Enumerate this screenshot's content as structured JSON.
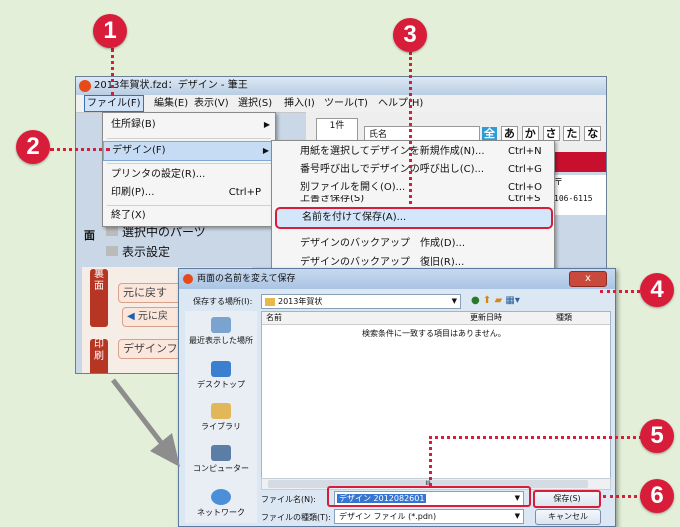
{
  "app": {
    "title": "2013年賀状.fzd：デザイン - 筆王",
    "menu": [
      "ファイル(F)",
      "編集(E)",
      "表示(V)",
      "選択(S)",
      "挿入(I)",
      "ツール(T)",
      "ヘルプ(H)"
    ],
    "ribbon": {
      "count_label": "1件",
      "name_label": "氏名",
      "kana_tabs": [
        "全",
        "あ",
        "か",
        "さ",
        "た",
        "な",
        "は"
      ],
      "postal_mark": "〒",
      "postal_code": "106-6115"
    },
    "side": {
      "face_label": "面",
      "selected_parts": "選択中のパーツ",
      "display_settings": "表示設定",
      "back_strip": [
        "裏",
        "面"
      ],
      "print_strip": [
        "印",
        "刷"
      ],
      "undo_label": "元に戻す",
      "undo_btn": "元に戻",
      "design_label": "デザインフ"
    }
  },
  "file_menu": {
    "items": [
      {
        "label": "住所録(B)",
        "shortcut": "",
        "arrow": true
      },
      {
        "label": "デザイン(F)",
        "shortcut": "",
        "arrow": true
      },
      {
        "label": "プリンタの設定(R)...",
        "shortcut": "",
        "arrow": false
      },
      {
        "label": "印刷(P)...",
        "shortcut": "Ctrl+P",
        "arrow": false
      },
      {
        "label": "終了(X)",
        "shortcut": "",
        "arrow": false
      }
    ]
  },
  "design_submenu": {
    "items": [
      {
        "label": "用紙を選択してデザインを新規作成(N)...",
        "shortcut": "Ctrl+N"
      },
      {
        "label": "番号呼び出しでデザインの呼び出し(C)...",
        "shortcut": "Ctrl+G"
      },
      {
        "label": "別ファイルを開く(O)...",
        "shortcut": "Ctrl+O"
      },
      {
        "label": "上書き保存(S)",
        "shortcut": "Ctrl+S"
      },
      {
        "label": "名前を付けて保存(A)...",
        "shortcut": ""
      },
      {
        "label": "デザインのバックアップ　作成(D)...",
        "shortcut": ""
      },
      {
        "label": "デザインのバックアップ　復旧(R)...",
        "shortcut": ""
      }
    ]
  },
  "dialog": {
    "title": "両面の名前を変えて保存",
    "close": "x",
    "save_in_label": "保存する場所(I):",
    "save_in_value": "2013年賀状",
    "columns": [
      "名前",
      "更新日時",
      "種類"
    ],
    "empty_message": "検索条件に一致する項目はありません。",
    "places": [
      "最近表示した場所",
      "デスクトップ",
      "ライブラリ",
      "コンピューター",
      "ネットワーク"
    ],
    "filename_label": "ファイル名(N):",
    "filename_value": "デザイン 2012082601",
    "filetype_label": "ファイルの種類(T):",
    "filetype_value": "デザイン ファイル (*.pdn)",
    "save_button": "保存(S)",
    "cancel_button": "キャンセル",
    "scroll_mark": "III"
  },
  "badges": [
    "1",
    "2",
    "3",
    "4",
    "5",
    "6"
  ],
  "colors": {
    "badge": "#d81d3a",
    "background": "#e3efd8",
    "selection": "#c6dcf5",
    "red_band": "#c8102e"
  }
}
